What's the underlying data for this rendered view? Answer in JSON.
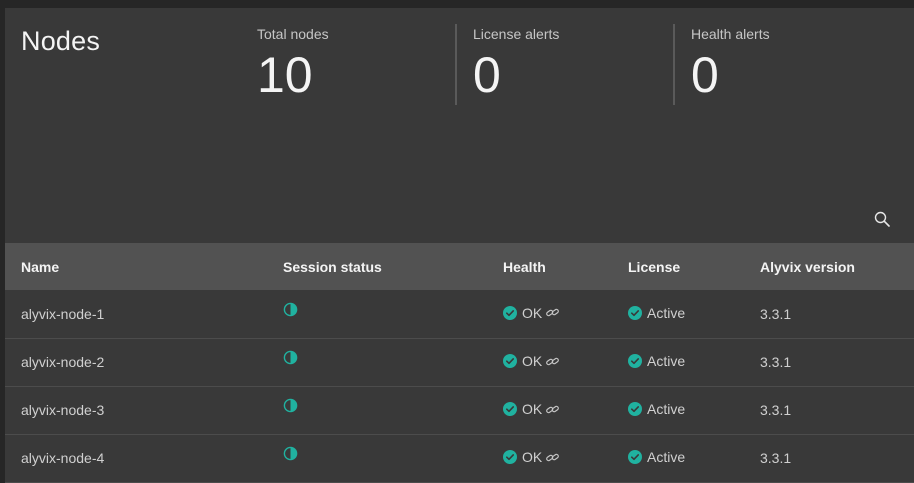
{
  "page": {
    "title": "Nodes"
  },
  "stats": [
    {
      "label": "Total nodes",
      "value": "10"
    },
    {
      "label": "License alerts",
      "value": "0"
    },
    {
      "label": "Health alerts",
      "value": "0"
    }
  ],
  "table": {
    "columns": [
      "Name",
      "Session status",
      "Health",
      "License",
      "Alyvix version"
    ],
    "rows": [
      {
        "name": "alyvix-node-1",
        "health": "OK",
        "license": "Active",
        "version": "3.3.1"
      },
      {
        "name": "alyvix-node-2",
        "health": "OK",
        "license": "Active",
        "version": "3.3.1"
      },
      {
        "name": "alyvix-node-3",
        "health": "OK",
        "license": "Active",
        "version": "3.3.1"
      },
      {
        "name": "alyvix-node-4",
        "health": "OK",
        "license": "Active",
        "version": "3.3.1"
      }
    ]
  },
  "icons": {
    "search": "search-icon",
    "session": "session-pie-icon",
    "status_ok": "check-circle-icon",
    "link": "link-icon"
  },
  "colors": {
    "accent": "#20b2a0",
    "background": "#393939",
    "header": "#525252"
  }
}
